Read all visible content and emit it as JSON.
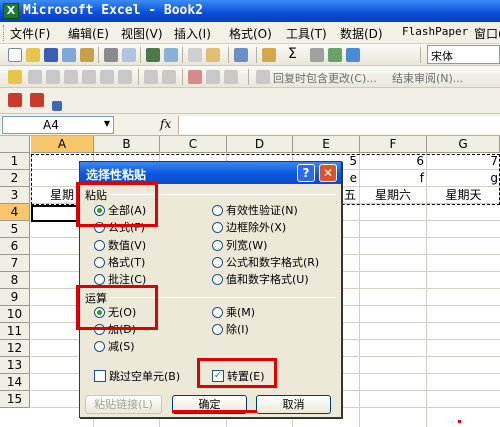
{
  "window": {
    "title": "Microsoft Excel - Book2",
    "app_icon": "excel-icon"
  },
  "menu": {
    "items": [
      "文件(F)",
      "编辑(E)",
      "视图(V)",
      "插入(I)",
      "格式(O)",
      "工具(T)",
      "数据(D)",
      "FlashPaper",
      "窗口(W)"
    ]
  },
  "toolbar": {
    "font_name": "宋体",
    "sum_symbol": "Σ",
    "reply_changes": "回复时包含更改(C)...",
    "end_review": "结束审阅(N)..."
  },
  "formula_bar": {
    "name_box": "A4",
    "fx_label": "fx",
    "content": ""
  },
  "sheet": {
    "columns": [
      "A",
      "B",
      "C",
      "D",
      "E",
      "F",
      "G"
    ],
    "rows": [
      "1",
      "2",
      "3",
      "4",
      "5",
      "6",
      "7",
      "8",
      "9",
      "10",
      "11",
      "12",
      "13",
      "14",
      "15"
    ],
    "selected_column": "A",
    "selected_row": "4",
    "visible_cells": {
      "E1": "5",
      "F1": "6",
      "G1": "7",
      "E2": "e",
      "F2": "f",
      "G2": "g",
      "A3": "星期",
      "E3": "五",
      "F3": "星期六",
      "G3": "星期天"
    }
  },
  "dialog": {
    "title": "选择性粘贴",
    "paste_group": "粘贴",
    "paste_options": [
      {
        "label": "全部(A)",
        "checked": true
      },
      {
        "label": "公式(F)",
        "checked": false
      },
      {
        "label": "数值(V)",
        "checked": false
      },
      {
        "label": "格式(T)",
        "checked": false
      },
      {
        "label": "批注(C)",
        "checked": false
      },
      {
        "label": "有效性验证(N)",
        "checked": false
      },
      {
        "label": "边框除外(X)",
        "checked": false
      },
      {
        "label": "列宽(W)",
        "checked": false
      },
      {
        "label": "公式和数字格式(R)",
        "checked": false
      },
      {
        "label": "值和数字格式(U)",
        "checked": false
      }
    ],
    "operation_group": "运算",
    "operation_options": [
      {
        "label": "无(O)",
        "checked": true
      },
      {
        "label": "加(D)",
        "checked": false
      },
      {
        "label": "减(S)",
        "checked": false
      },
      {
        "label": "乘(M)",
        "checked": false
      },
      {
        "label": "除(I)",
        "checked": false
      }
    ],
    "skip_blanks": {
      "label": "跳过空单元(B)",
      "checked": false
    },
    "transpose": {
      "label": "转置(E)",
      "checked": true,
      "check_mark": "✓"
    },
    "buttons": {
      "paste_link": "粘贴链接(L)",
      "ok": "确定",
      "cancel": "取消"
    },
    "help_glyph": "?",
    "close_glyph": "✕"
  },
  "annotation_color": "#e00000"
}
